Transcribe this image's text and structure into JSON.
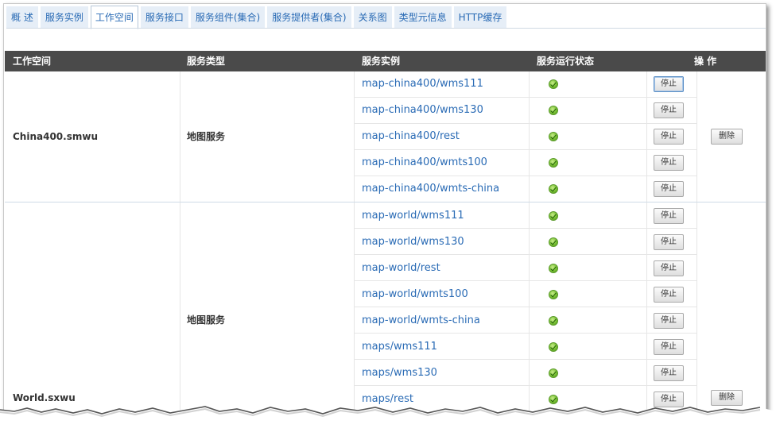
{
  "tabs": [
    {
      "label": "概 述"
    },
    {
      "label": "服务实例"
    },
    {
      "label": "工作空间",
      "active": true
    },
    {
      "label": "服务接口"
    },
    {
      "label": "服务组件(集合)"
    },
    {
      "label": "服务提供者(集合)"
    },
    {
      "label": "关系图"
    },
    {
      "label": "类型元信息"
    },
    {
      "label": "HTTP缓存"
    }
  ],
  "table": {
    "headers": {
      "workspace": "工作空间",
      "service_type": "服务类型",
      "service_instance": "服务实例",
      "run_status": "服务运行状态",
      "operation": "操 作"
    },
    "groups": [
      {
        "workspace": "China400.smwu",
        "service_type": "地图服务",
        "delete_label": "删除",
        "instances": [
          {
            "name": "map-china400/wms111",
            "stop_label": "停止"
          },
          {
            "name": "map-china400/wms130",
            "stop_label": "停止"
          },
          {
            "name": "map-china400/rest",
            "stop_label": "停止"
          },
          {
            "name": "map-china400/wmts100",
            "stop_label": "停止"
          },
          {
            "name": "map-china400/wmts-china",
            "stop_label": "停止"
          }
        ]
      },
      {
        "workspace": "World.sxwu",
        "service_type": "地图服务",
        "delete_label": "删除",
        "instances": [
          {
            "name": "map-world/wms111",
            "stop_label": "停止"
          },
          {
            "name": "map-world/wms130",
            "stop_label": "停止"
          },
          {
            "name": "map-world/rest",
            "stop_label": "停止"
          },
          {
            "name": "map-world/wmts100",
            "stop_label": "停止"
          },
          {
            "name": "map-world/wmts-china",
            "stop_label": "停止"
          },
          {
            "name": "maps/wms111",
            "stop_label": "停止"
          },
          {
            "name": "maps/wms130",
            "stop_label": "停止"
          },
          {
            "name": "maps/rest",
            "stop_label": "停止"
          }
        ]
      }
    ]
  },
  "colors": {
    "header_bg": "#4a4a4a",
    "link": "#2a6bb5",
    "tab_bg": "#e6eef7",
    "status_ok": "#79c233"
  },
  "icons": {
    "status": "green-check-circle-icon"
  }
}
